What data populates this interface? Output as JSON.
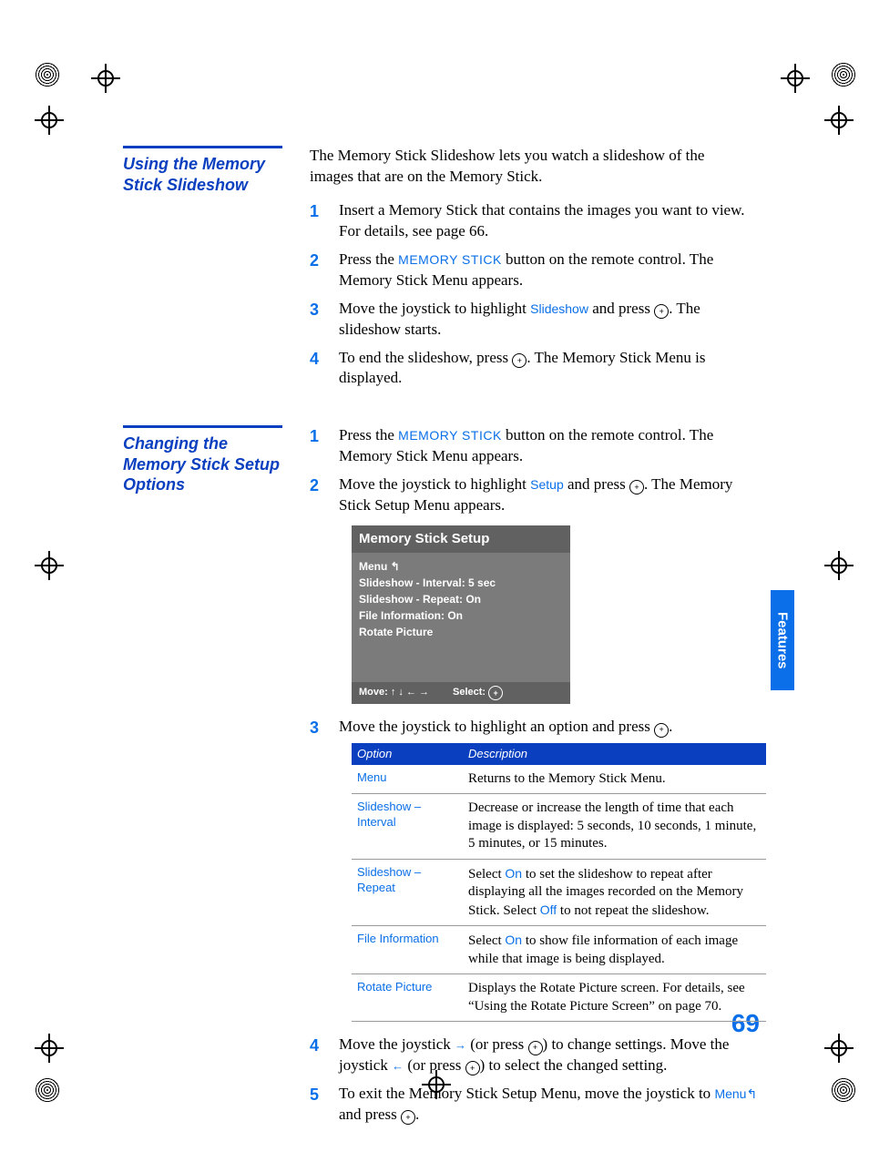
{
  "side_tab": "Features",
  "page_number": "69",
  "section1": {
    "title": "Using the Memory Stick Slideshow",
    "intro": "The Memory Stick Slideshow lets you watch a slideshow of the images that are on the Memory Stick.",
    "steps": {
      "s1": "Insert a Memory Stick that contains the images you want to view. For details, see page 66.",
      "s2a": "Press the ",
      "s2_kw": "MEMORY STICK",
      "s2b": " button on the remote control. The Memory Stick Menu appears.",
      "s3a": "Move the joystick to highlight ",
      "s3_kw": "Slideshow",
      "s3b": " and press ",
      "s3c": ". The slideshow starts.",
      "s4a": "To end the slideshow, press ",
      "s4b": ". The Memory Stick Menu is displayed."
    }
  },
  "section2": {
    "title": "Changing the Memory Stick Setup Options",
    "steps": {
      "s1a": "Press the ",
      "s1_kw": "MEMORY STICK",
      "s1b": " button on the remote control. The Memory Stick Menu appears.",
      "s2a": "Move the joystick to highlight ",
      "s2_kw": "Setup",
      "s2b": " and press ",
      "s2c": ". The Memory Stick Setup Menu appears.",
      "s3a": "Move the joystick to highlight an option and press ",
      "s3b": ".",
      "s4a": "Move the joystick ",
      "s4b": " (or press ",
      "s4c": ") to change settings. Move the joystick ",
      "s4d": " (or press ",
      "s4e": ") to select the changed setting.",
      "s5a": "To exit the Memory Stick Setup Menu, move the joystick to ",
      "s5_kw": "Menu",
      "s5b": " and press ",
      "s5c": "."
    }
  },
  "osd": {
    "title": "Memory Stick Setup",
    "items": [
      "Menu ↰",
      "Slideshow - Interval: 5 sec",
      "Slideshow - Repeat: On",
      "File Information: On",
      "Rotate Picture"
    ],
    "foot_move": "Move: ",
    "foot_arrows": "↑ ↓ ← →",
    "foot_select": "Select: "
  },
  "table": {
    "head_option": "Option",
    "head_desc": "Description",
    "rows": [
      {
        "opt": "Menu",
        "desc": "Returns to the Memory Stick Menu."
      },
      {
        "opt": "Slideshow – Interval",
        "desc": "Decrease or increase the length of time that each image is displayed: 5 seconds, 10 seconds, 1 minute, 5 minutes, or 15 minutes."
      },
      {
        "opt": "Slideshow – Repeat",
        "desc_a": "Select ",
        "on": "On",
        "desc_b": " to set the slideshow to repeat after displaying all the images recorded on the Memory Stick. Select ",
        "off": "Off",
        "desc_c": " to not repeat the slideshow."
      },
      {
        "opt": "File Information",
        "desc_a": "Select ",
        "on": "On",
        "desc_b": " to show file information of each image while that image is being displayed."
      },
      {
        "opt": "Rotate Picture",
        "desc": "Displays the Rotate Picture screen. For details, see “Using the Rotate Picture Screen” on page 70."
      }
    ]
  }
}
